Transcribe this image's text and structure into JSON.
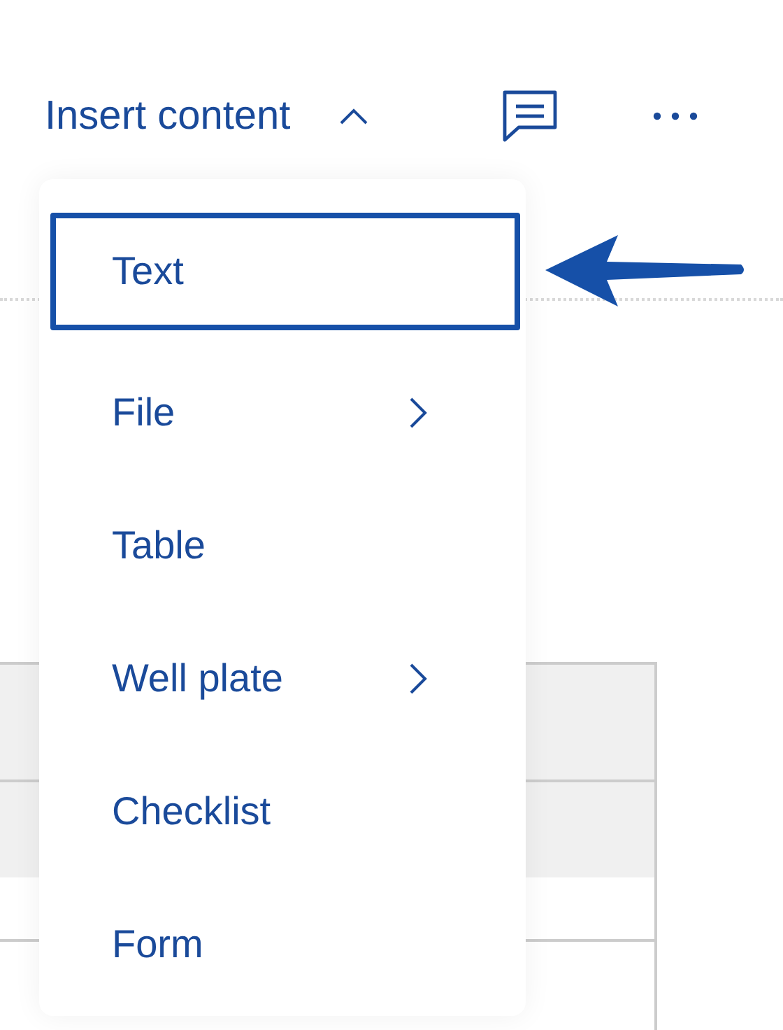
{
  "toolbar": {
    "insert_label": "Insert content",
    "expanded": true
  },
  "menu": {
    "items": [
      {
        "label": "Text",
        "selected": true,
        "submenu": false
      },
      {
        "label": "File",
        "selected": false,
        "submenu": true
      },
      {
        "label": "Table",
        "selected": false,
        "submenu": false
      },
      {
        "label": "Well plate",
        "selected": false,
        "submenu": true
      },
      {
        "label": "Checklist",
        "selected": false,
        "submenu": false
      },
      {
        "label": "Form",
        "selected": false,
        "submenu": false
      }
    ]
  }
}
